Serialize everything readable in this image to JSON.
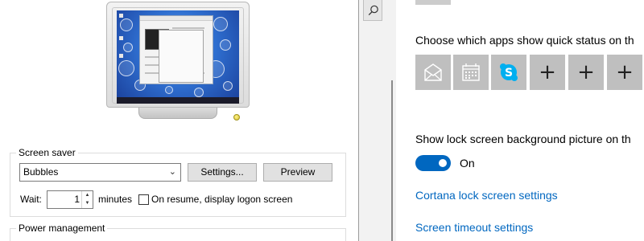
{
  "screen_saver_dialog": {
    "screen_saver_group_label": "Screen saver",
    "selected_screen_saver": "Bubbles",
    "settings_button": "Settings...",
    "preview_button": "Preview",
    "wait_label": "Wait:",
    "wait_minutes": "1",
    "minutes_label": "minutes",
    "on_resume_checked": false,
    "on_resume_label": "On resume, display logon screen",
    "power_management_group_label": "Power management"
  },
  "lock_screen_settings": {
    "quick_status_heading": "Choose which apps show quick status on th",
    "quick_status_apps": [
      {
        "name": "Mail",
        "icon": "mail-icon"
      },
      {
        "name": "Calendar",
        "icon": "calendar-icon"
      },
      {
        "name": "Skype",
        "icon": "skype-icon"
      },
      {
        "name": "",
        "icon": "plus-icon"
      },
      {
        "name": "",
        "icon": "plus-icon"
      },
      {
        "name": "",
        "icon": "plus-icon"
      }
    ],
    "background_picture_heading": "Show lock screen background picture on th",
    "background_toggle_state": "On",
    "cortana_link": "Cortana lock screen settings",
    "screen_timeout_link": "Screen timeout settings"
  },
  "colors": {
    "accent": "#0067c0",
    "tile_background": "#bfbfbf",
    "skype_blue": "#00aff0"
  }
}
